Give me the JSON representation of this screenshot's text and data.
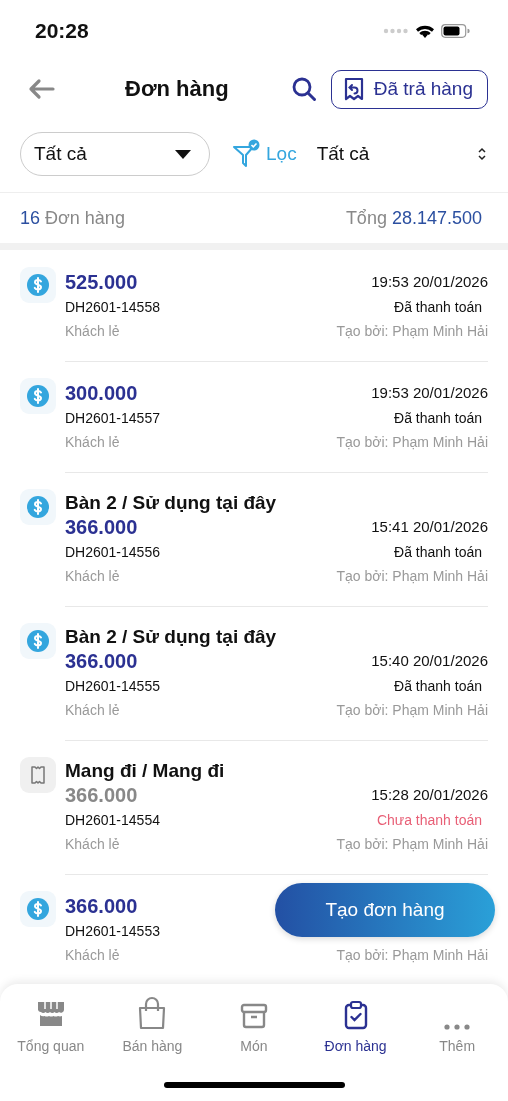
{
  "status_bar": {
    "time": "20:28"
  },
  "header": {
    "title": "Đơn hàng",
    "returns_button": "Đã trả hàng"
  },
  "filters": {
    "status_select": "Tất cả",
    "filter_label": "Lọc",
    "filter_active": true,
    "sort_select": "Tất cả"
  },
  "summary": {
    "count": "16",
    "count_label": "Đơn hàng",
    "total_label": "Tổng",
    "total": "28.147.500"
  },
  "orders": [
    {
      "kind": "paid",
      "amount": "525.000",
      "time": "19:53 20/01/2026",
      "code": "DH2601-14558",
      "status": "Đã thanh toán",
      "customer": "Khách lẻ",
      "creator": "Tạo bởi: Phạm Minh Hải"
    },
    {
      "kind": "paid",
      "amount": "300.000",
      "time": "19:53 20/01/2026",
      "code": "DH2601-14557",
      "status": "Đã thanh toán",
      "customer": "Khách lẻ",
      "creator": "Tạo bởi: Phạm Minh Hải"
    },
    {
      "kind": "paid",
      "title": "Bàn 2 / Sử dụng tại đây",
      "amount": "366.000",
      "time": "15:41 20/01/2026",
      "code": "DH2601-14556",
      "status": "Đã thanh toán",
      "customer": "Khách lẻ",
      "creator": "Tạo bởi: Phạm Minh Hải"
    },
    {
      "kind": "paid",
      "title": "Bàn 2 / Sử dụng tại đây",
      "amount": "366.000",
      "time": "15:40 20/01/2026",
      "code": "DH2601-14555",
      "status": "Đã thanh toán",
      "customer": "Khách lẻ",
      "creator": "Tạo bởi: Phạm Minh Hải"
    },
    {
      "kind": "unpaid",
      "title": "Mang đi / Mang đi",
      "amount": "366.000",
      "time": "15:28 20/01/2026",
      "code": "DH2601-14554",
      "status": "Chưa thanh toán",
      "customer": "Khách lẻ",
      "creator": "Tạo bởi: Phạm Minh Hải"
    },
    {
      "kind": "paid",
      "amount": "366.000",
      "code": "DH2601-14553",
      "customer": "Khách lẻ",
      "creator": "Tạo bởi: Phạm Minh Hải"
    }
  ],
  "create_button": "Tạo đơn hàng",
  "tabs": [
    {
      "kind": "store",
      "label": "Tổng quan",
      "selected": false
    },
    {
      "kind": "bag",
      "label": "Bán hàng",
      "selected": false
    },
    {
      "kind": "box",
      "label": "Món",
      "selected": false
    },
    {
      "kind": "clipboard",
      "label": "Đơn hàng",
      "selected": true
    },
    {
      "kind": "more",
      "label": "Thêm",
      "selected": false
    }
  ]
}
